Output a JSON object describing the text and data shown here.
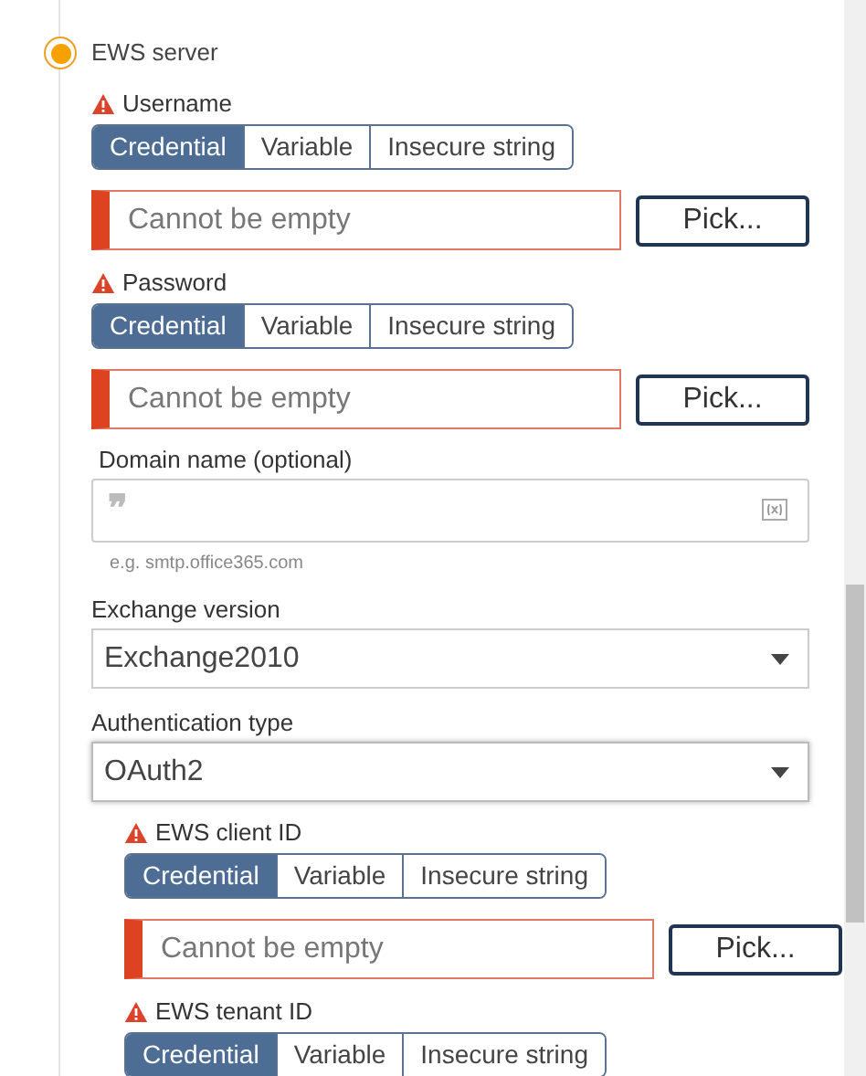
{
  "server": {
    "label": "EWS server",
    "selected": true
  },
  "credentials": [
    {
      "label": "Username",
      "warning": true,
      "modes": [
        {
          "label": "Credential",
          "selected": true
        },
        {
          "label": "Variable",
          "selected": false
        },
        {
          "label": "Insecure string",
          "selected": false
        }
      ],
      "placeholder": "Cannot be empty",
      "button": "Pick..."
    },
    {
      "label": "Password",
      "warning": true,
      "modes": [
        {
          "label": "Credential",
          "selected": true
        },
        {
          "label": "Variable",
          "selected": false
        },
        {
          "label": "Insecure string",
          "selected": false
        }
      ],
      "placeholder": "Cannot be empty",
      "button": "Pick..."
    }
  ],
  "domain": {
    "label": "Domain name (optional)",
    "placeholder": "❞",
    "hint": "e.g. smtp.office365.com"
  },
  "exchange": {
    "label": "Exchange version",
    "value": "Exchange2010"
  },
  "auth": {
    "label": "Authentication type",
    "value": "OAuth2",
    "credentials": [
      {
        "label": "EWS client ID",
        "warning": true,
        "modes": [
          {
            "label": "Credential",
            "selected": true
          },
          {
            "label": "Variable",
            "selected": false
          },
          {
            "label": "Insecure string",
            "selected": false
          }
        ],
        "placeholder": "Cannot be empty",
        "button": "Pick..."
      },
      {
        "label": "EWS tenant ID",
        "warning": true,
        "modes": [
          {
            "label": "Credential",
            "selected": true
          },
          {
            "label": "Variable",
            "selected": false
          },
          {
            "label": "Insecure string",
            "selected": false
          }
        ]
      }
    ]
  }
}
